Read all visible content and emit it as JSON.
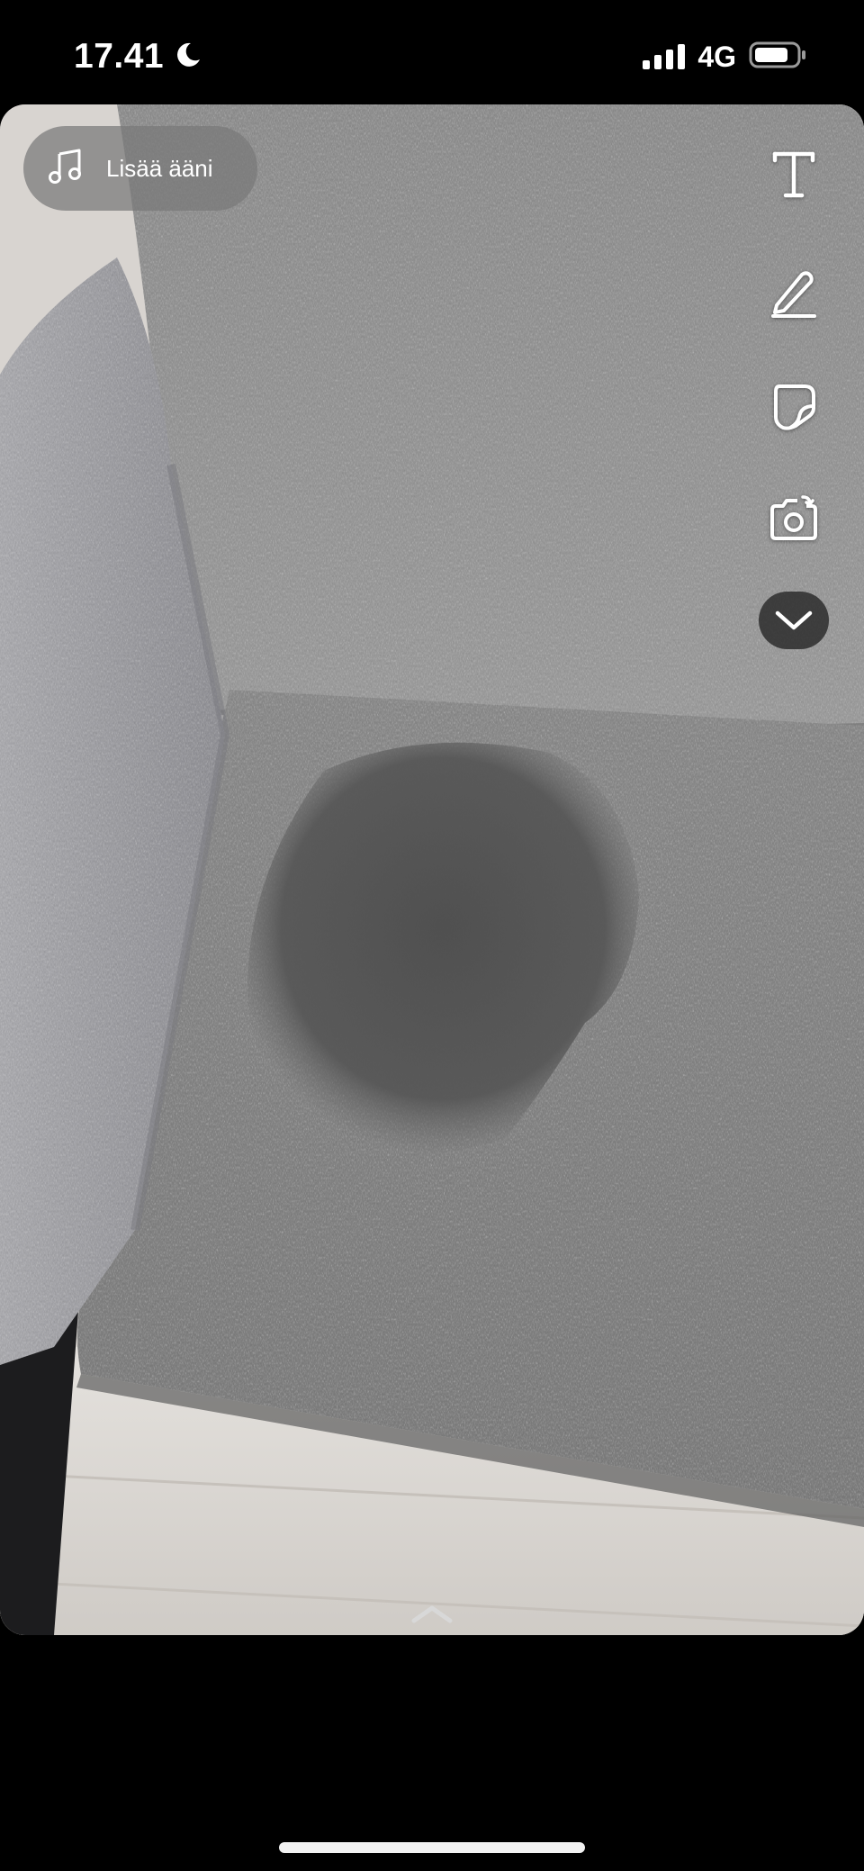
{
  "status_bar": {
    "time": "17.41",
    "network": "4G",
    "moon_icon": "moon-icon",
    "signal_icon": "cellular-signal-icon",
    "battery_icon": "battery-icon"
  },
  "editor": {
    "add_sound_label": "Lisää ääni",
    "add_sound_icon": "music-note-icon",
    "tools": [
      {
        "name": "text-tool",
        "icon": "text-icon"
      },
      {
        "name": "draw-tool",
        "icon": "pencil-icon"
      },
      {
        "name": "sticker-tool",
        "icon": "sticker-icon"
      },
      {
        "name": "camera-flip-tool",
        "icon": "camera-retake-icon"
      },
      {
        "name": "more-tools",
        "icon": "chevron-down-icon"
      }
    ],
    "swipe_hint_icon": "chevron-up-icon"
  },
  "photo": {
    "subject": "photo-of-stained-sofa-cushion"
  },
  "colors": {
    "background": "#000000",
    "fabric_light": "#9a9a9a",
    "fabric_dark": "#707070",
    "stain": "#555555",
    "floor": "#d9d6d2",
    "pill": "#787878"
  }
}
